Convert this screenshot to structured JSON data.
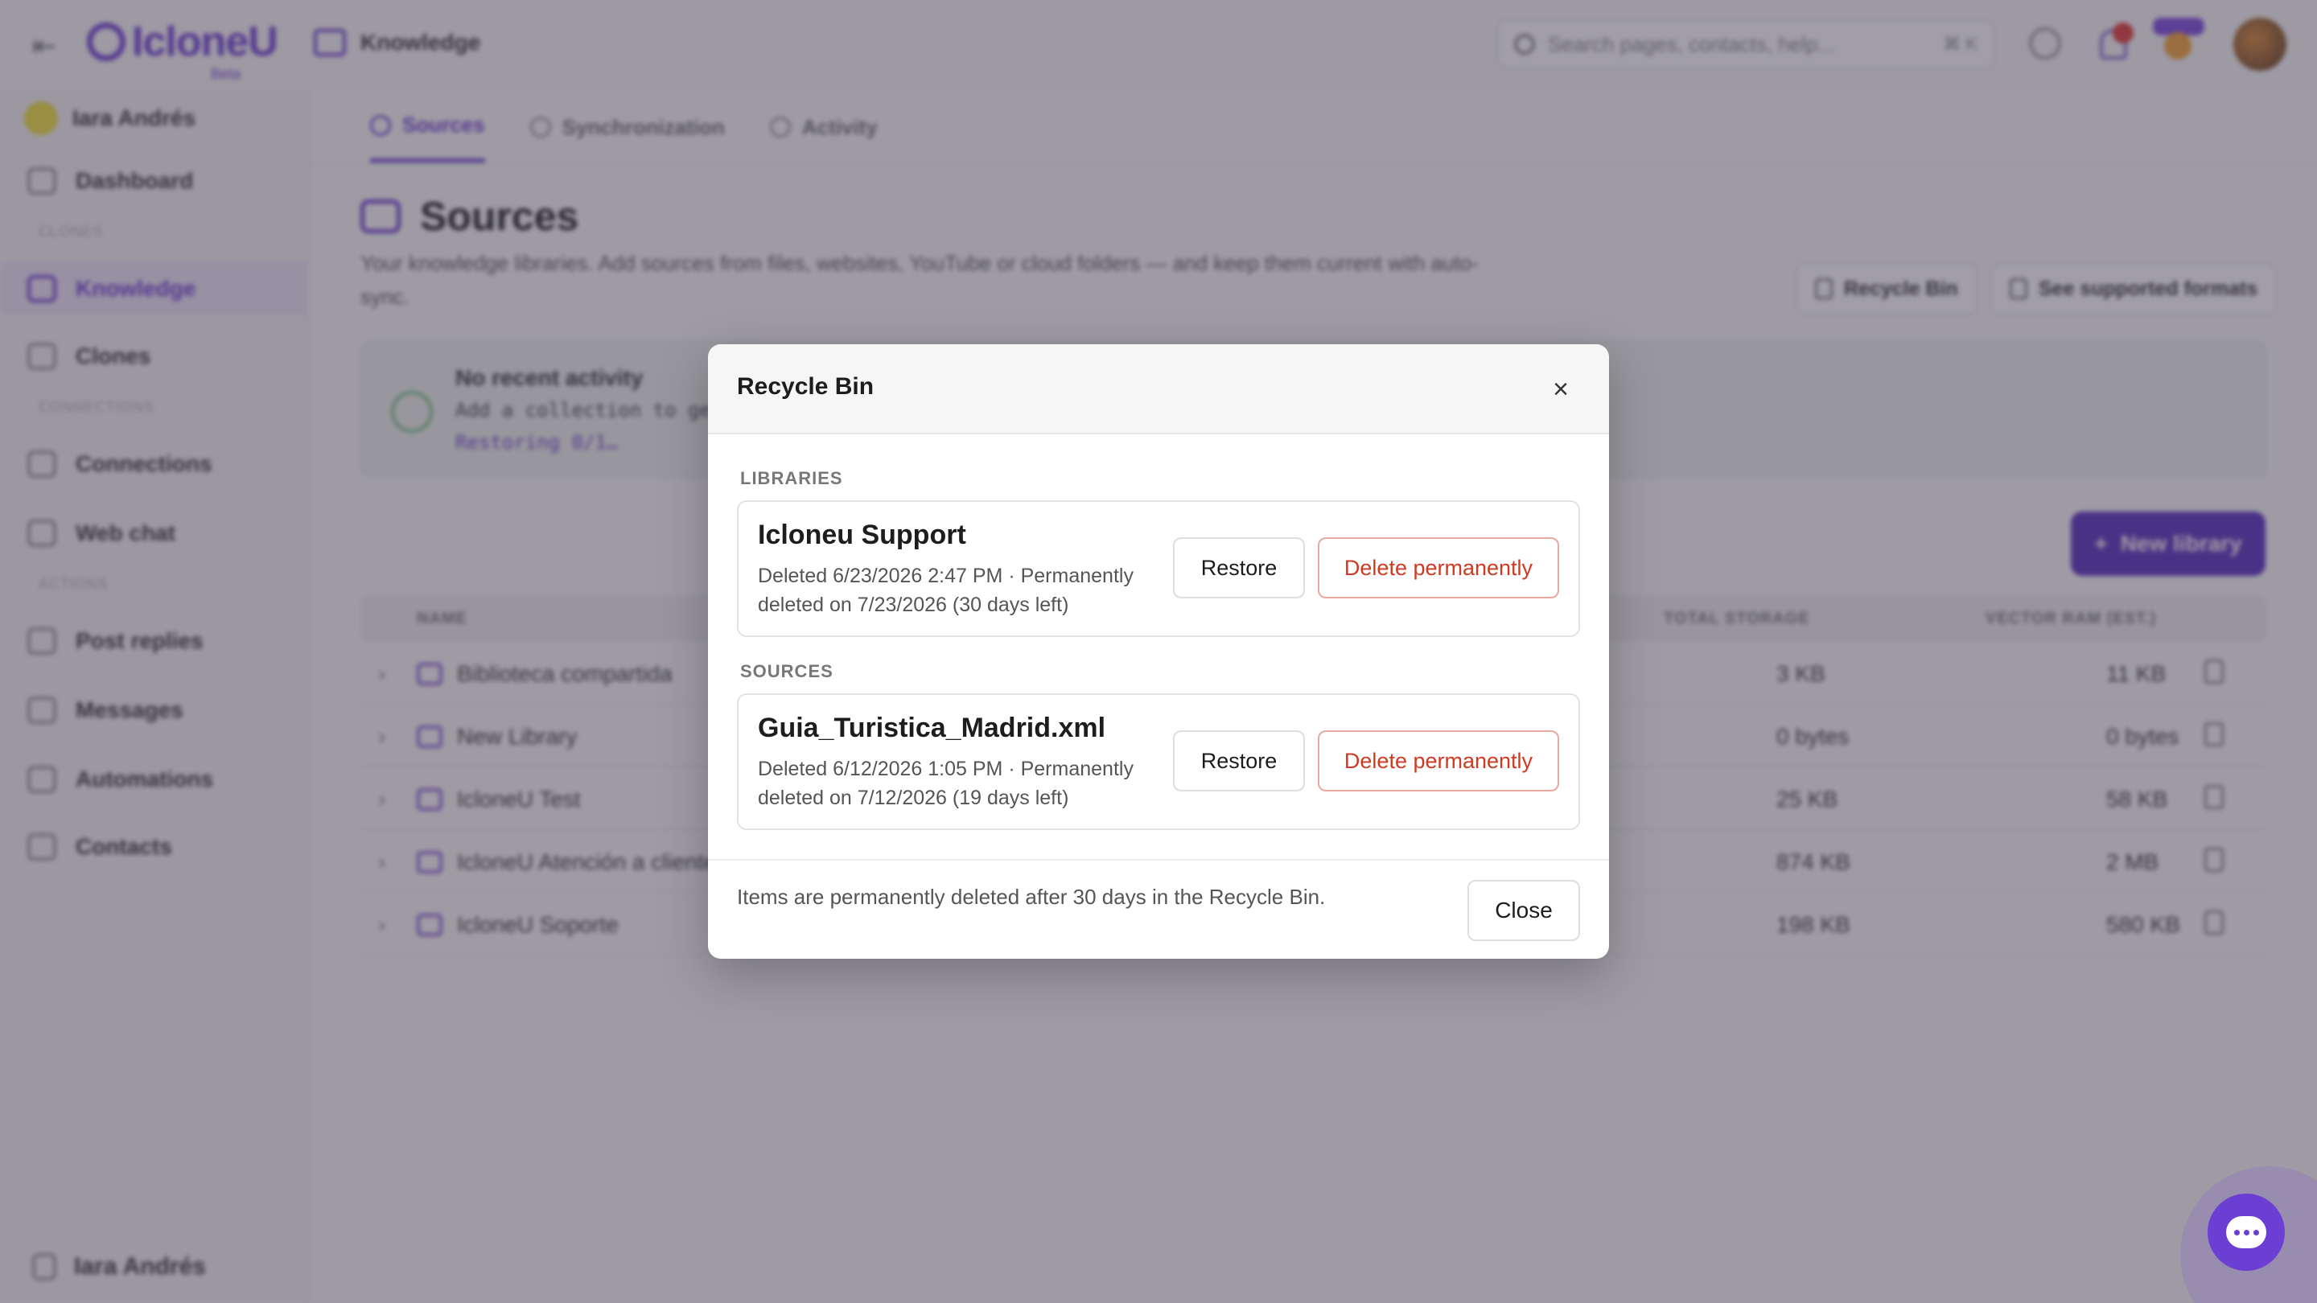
{
  "app": {
    "logo_text": "IcloneU",
    "logo_sub": "Beta",
    "breadcrumb": "Knowledge",
    "search_placeholder": "Search pages, contacts, help...",
    "search_shortcut": "⌘ K",
    "user_name": "Iara Andrés"
  },
  "sidebar": {
    "items": [
      {
        "label": "Dashboard"
      },
      {
        "label": "Knowledge"
      },
      {
        "label": "Clones"
      },
      {
        "label": "Connections"
      },
      {
        "label": "Web chat"
      },
      {
        "label": "Post replies"
      },
      {
        "label": "Messages"
      },
      {
        "label": "Automations"
      },
      {
        "label": "Contacts"
      }
    ],
    "sections": [
      "CLONES",
      "CONNECTIONS",
      "ACTIONS"
    ]
  },
  "tabs": [
    {
      "label": "Sources"
    },
    {
      "label": "Synchronization"
    },
    {
      "label": "Activity"
    }
  ],
  "page": {
    "title": "Sources",
    "description": "Your knowledge libraries. Add sources from files, websites, YouTube or cloud folders — and keep them current with auto-sync.",
    "recycle_bin_button": "Recycle Bin",
    "formats_button": "See supported formats",
    "activity_title": "No recent activity",
    "activity_line": "Add a collection to get started",
    "activity_link": "Restoring 0/1…",
    "new_library_button": "New library"
  },
  "table": {
    "headers": {
      "name": "NAME",
      "storage": "TOTAL STORAGE",
      "vector": "VECTOR RAM (EST.)"
    },
    "rows": [
      {
        "name": "Biblioteca compartida",
        "storage": "3 KB",
        "vector": "11 KB"
      },
      {
        "name": "New Library",
        "storage": "0 bytes",
        "vector": "0 bytes"
      },
      {
        "name": "IcloneU Test",
        "storage": "25 KB",
        "vector": "58 KB"
      },
      {
        "name": "IcloneU Atención a clientes",
        "storage": "874 KB",
        "vector": "2 MB"
      },
      {
        "name": "IcloneU Soporte",
        "storage": "198 KB",
        "vector": "580 KB"
      }
    ]
  },
  "modal": {
    "title": "Recycle Bin",
    "close_icon": "×",
    "libraries_label": "LIBRARIES",
    "sources_label": "SOURCES",
    "libraries": [
      {
        "name": "Icloneu Support",
        "meta": "Deleted 6/23/2026 2:47 PM · Permanently deleted on 7/23/2026 (30 days left)",
        "restore": "Restore",
        "delete": "Delete permanently"
      }
    ],
    "sources": [
      {
        "name": "Guia_Turistica_Madrid.xml",
        "meta": "Deleted 6/12/2026 1:05 PM · Permanently deleted on 7/12/2026 (19 days left)",
        "restore": "Restore",
        "delete": "Delete permanently"
      }
    ],
    "footer_note": "Items are permanently deleted after 30 days in the Recycle Bin.",
    "close_button": "Close"
  },
  "colors": {
    "accent": "#6b3fd4",
    "danger": "#d13a1f"
  }
}
